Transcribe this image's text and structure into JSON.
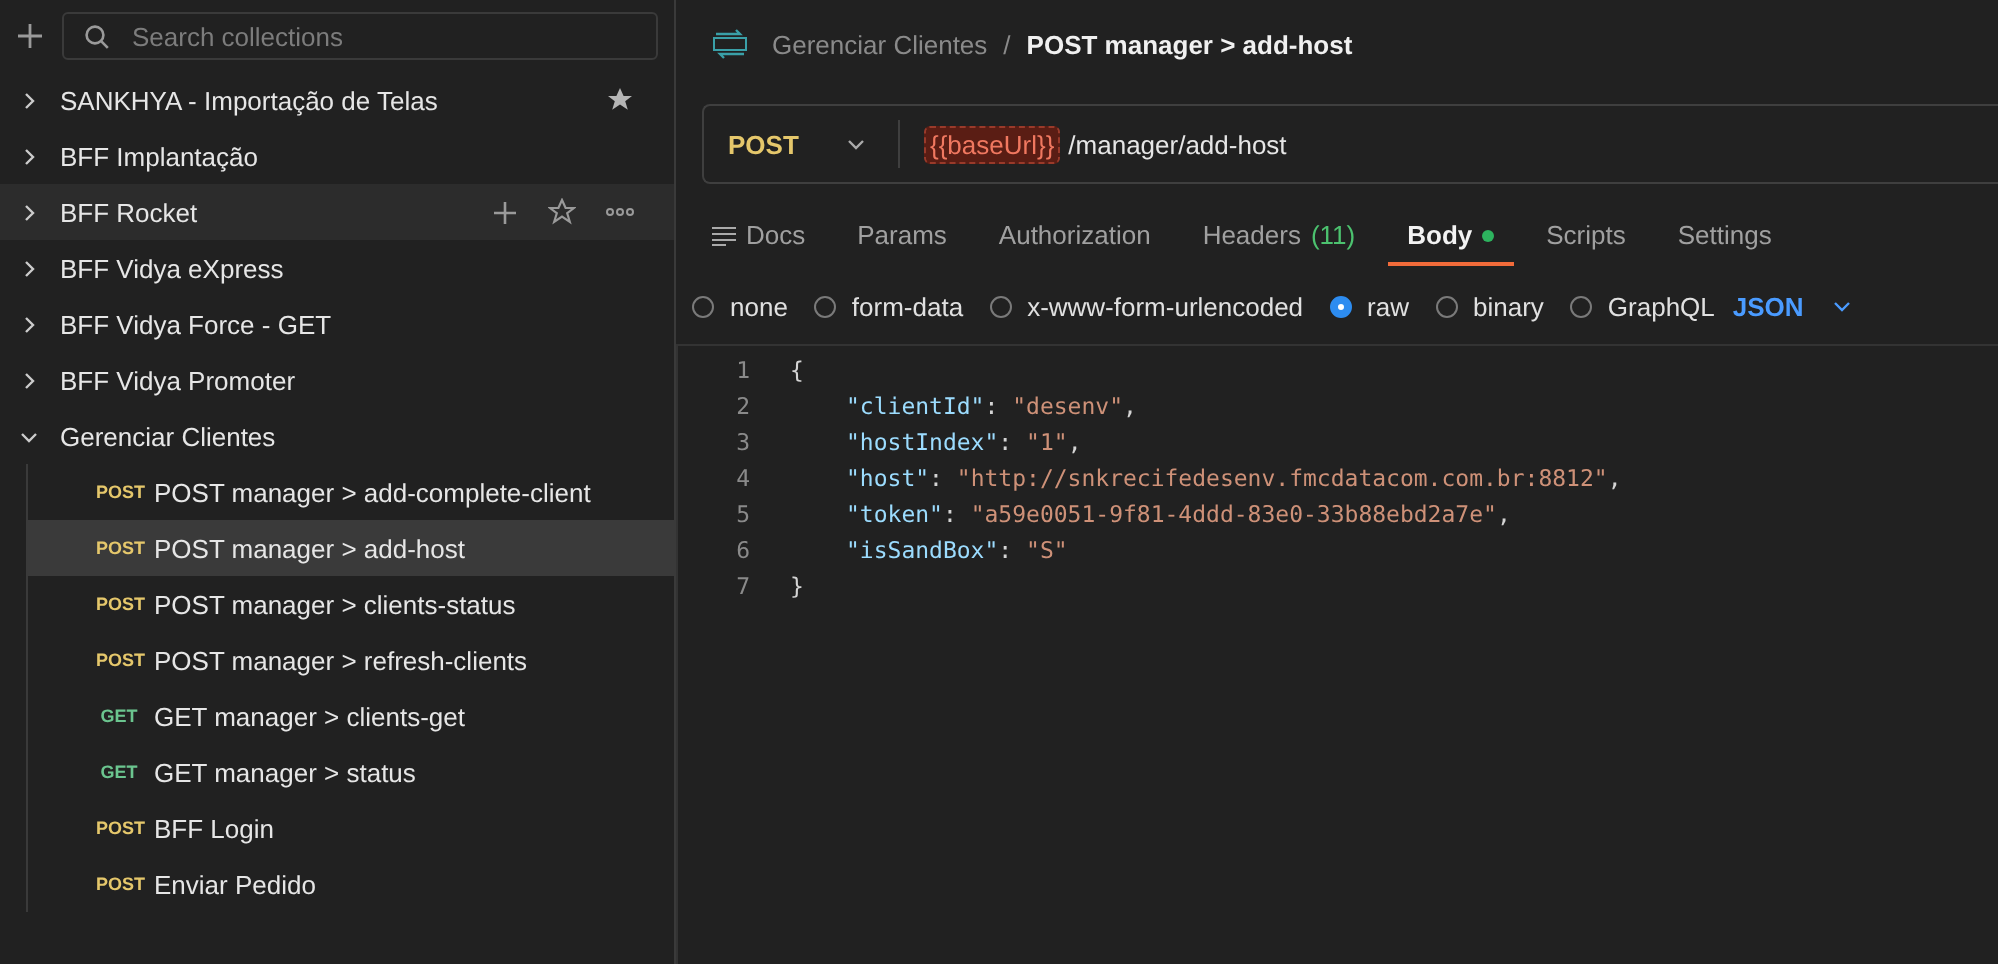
{
  "sidebar": {
    "search": {
      "placeholder": "Search collections"
    },
    "collections": [
      {
        "name": "SANKHYA - Importação de Telas",
        "expanded": false,
        "favorite": true,
        "hovered": false
      },
      {
        "name": "BFF Implantação",
        "expanded": false,
        "favorite": false,
        "hovered": false
      },
      {
        "name": "BFF Rocket",
        "expanded": false,
        "favorite": false,
        "hovered": true
      },
      {
        "name": "BFF Vidya eXpress",
        "expanded": false,
        "favorite": false,
        "hovered": false
      },
      {
        "name": "BFF Vidya Force - GET",
        "expanded": false,
        "favorite": false,
        "hovered": false
      },
      {
        "name": "BFF Vidya Promoter",
        "expanded": false,
        "favorite": false,
        "hovered": false
      },
      {
        "name": "Gerenciar Clientes",
        "expanded": true,
        "favorite": false,
        "hovered": false,
        "children": [
          {
            "method": "POST",
            "name": "POST manager > add-complete-client",
            "selected": false
          },
          {
            "method": "POST",
            "name": "POST manager > add-host",
            "selected": true
          },
          {
            "method": "POST",
            "name": "POST manager > clients-status",
            "selected": false
          },
          {
            "method": "POST",
            "name": "POST manager > refresh-clients",
            "selected": false
          },
          {
            "method": "GET",
            "name": "GET manager > clients-get",
            "selected": false
          },
          {
            "method": "GET",
            "name": "GET manager > status",
            "selected": false
          },
          {
            "method": "POST",
            "name": "BFF Login",
            "selected": false
          },
          {
            "method": "POST",
            "name": "Enviar Pedido",
            "selected": false
          }
        ]
      }
    ]
  },
  "breadcrumb": {
    "parent": "Gerenciar Clientes",
    "separator": "/",
    "current": "POST manager > add-host"
  },
  "request": {
    "method": "POST",
    "variable": "{{baseUrl}}",
    "path": "/manager/add-host"
  },
  "tabs": [
    {
      "label": "Docs",
      "kind": "docs",
      "selected": false
    },
    {
      "label": "Params",
      "selected": false
    },
    {
      "label": "Authorization",
      "selected": false
    },
    {
      "label": "Headers",
      "count": "(11)",
      "selected": false
    },
    {
      "label": "Body",
      "has_content": true,
      "selected": true
    },
    {
      "label": "Scripts",
      "selected": false
    },
    {
      "label": "Settings",
      "selected": false
    }
  ],
  "body_types": [
    {
      "label": "none",
      "selected": false
    },
    {
      "label": "form-data",
      "selected": false
    },
    {
      "label": "x-www-form-urlencoded",
      "selected": false
    },
    {
      "label": "raw",
      "selected": true
    },
    {
      "label": "binary",
      "selected": false
    },
    {
      "label": "GraphQL",
      "selected": false
    }
  ],
  "format": "JSON",
  "code": [
    {
      "number": "1",
      "tokens": [
        {
          "kind": "brace",
          "text": "{"
        }
      ]
    },
    {
      "number": "2",
      "tokens": [
        {
          "kind": "key",
          "text": "\"clientId\""
        },
        {
          "kind": "punct",
          "text": ": "
        },
        {
          "kind": "string",
          "text": "\"desenv\""
        },
        {
          "kind": "punct",
          "text": ","
        }
      ]
    },
    {
      "number": "3",
      "tokens": [
        {
          "kind": "key",
          "text": "\"hostIndex\""
        },
        {
          "kind": "punct",
          "text": ": "
        },
        {
          "kind": "string",
          "text": "\"1\""
        },
        {
          "kind": "punct",
          "text": ","
        }
      ]
    },
    {
      "number": "4",
      "tokens": [
        {
          "kind": "key",
          "text": "\"host\""
        },
        {
          "kind": "punct",
          "text": ": "
        },
        {
          "kind": "string",
          "text": "\"http://snkrecifedesenv.fmcdatacom.com.br:8812\""
        },
        {
          "kind": "punct",
          "text": ","
        }
      ]
    },
    {
      "number": "5",
      "tokens": [
        {
          "kind": "key",
          "text": "\"token\""
        },
        {
          "kind": "punct",
          "text": ": "
        },
        {
          "kind": "string",
          "text": "\"a59e0051-9f81-4ddd-83e0-33b88ebd2a7e\""
        },
        {
          "kind": "punct",
          "text": ","
        }
      ]
    },
    {
      "number": "6",
      "tokens": [
        {
          "kind": "key",
          "text": "\"isSandBox\""
        },
        {
          "kind": "punct",
          "text": ": "
        },
        {
          "kind": "string",
          "text": "\"S\""
        }
      ]
    },
    {
      "number": "7",
      "tokens": [
        {
          "kind": "brace",
          "text": "}"
        }
      ]
    }
  ]
}
